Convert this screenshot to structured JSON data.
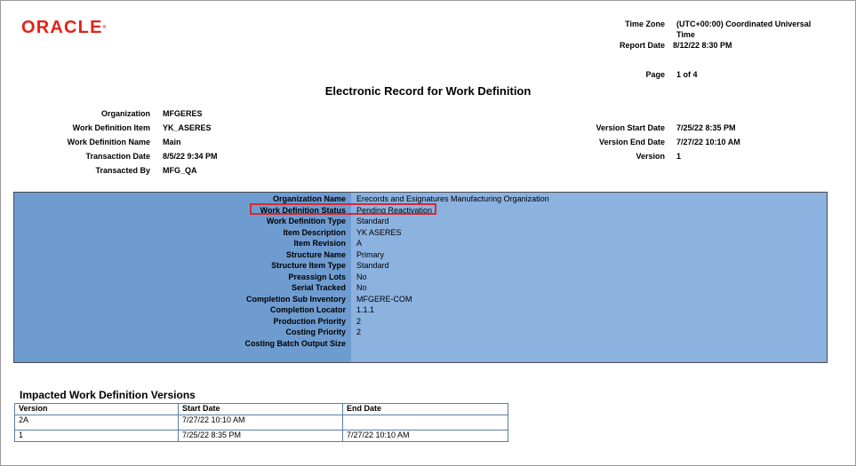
{
  "logo": {
    "text": "ORACLE",
    "mark": "®"
  },
  "header": {
    "time_zone_label": "Time Zone",
    "time_zone_value_line1": "(UTC+00:00) Coordinated Universal",
    "time_zone_value_line2": "Time",
    "report_date_label": "Report Date",
    "report_date_value": "8/12/22 8:30 PM",
    "page_label": "Page",
    "page_value": "1 of 4"
  },
  "title": "Electronic Record for Work Definition",
  "summary_left": [
    {
      "label": "Organization",
      "value": "MFGERES"
    },
    {
      "label": "Work Definition Item",
      "value": "YK_ASERES"
    },
    {
      "label": "Work Definition Name",
      "value": "Main"
    },
    {
      "label": "Transaction Date",
      "value": "8/5/22 9:34 PM"
    },
    {
      "label": "Transacted By",
      "value": "MFG_QA"
    }
  ],
  "summary_right": [
    {
      "label": "Version Start Date",
      "value": "7/25/22 8:35 PM"
    },
    {
      "label": "Version End Date",
      "value": "7/27/22 10:10 AM"
    },
    {
      "label": "Version",
      "value": "1"
    }
  ],
  "details": [
    {
      "label": "Organization Name",
      "value": "Erecords and Esignatures Manufacturing Organization"
    },
    {
      "label": "Work Definition Status",
      "value": "Pending Reactivation"
    },
    {
      "label": "Work Definition Type",
      "value": "Standard"
    },
    {
      "label": "Item Description",
      "value": "YK ASERES"
    },
    {
      "label": "Item Revision",
      "value": "A"
    },
    {
      "label": "Structure Name",
      "value": "Primary"
    },
    {
      "label": "Structure Item Type",
      "value": "Standard"
    },
    {
      "label": "Preassign Lots",
      "value": "No"
    },
    {
      "label": "Serial Tracked",
      "value": "No"
    },
    {
      "label": "Completion Sub Inventory",
      "value": "MFGERE-COM"
    },
    {
      "label": "Completion Locator",
      "value": "1.1.1"
    },
    {
      "label": "Production Priority",
      "value": "2"
    },
    {
      "label": "Costing Priority",
      "value": "2"
    },
    {
      "label": "Costing Batch Output Size",
      "value": ""
    }
  ],
  "versions_section": {
    "title": "Impacted Work Definition Versions",
    "columns": [
      "Version",
      "Start Date",
      "End Date"
    ],
    "rows": [
      [
        "2A",
        "7/27/22 10:10 AM",
        ""
      ],
      [
        "1",
        "7/25/22 8:35 PM",
        "7/27/22 10:10 AM"
      ]
    ]
  },
  "colors": {
    "brand_red": "#e2231a",
    "detail_label_bg": "#6f9cd0",
    "detail_value_bg": "#8cb2e0",
    "highlight_border": "#d42a35"
  }
}
